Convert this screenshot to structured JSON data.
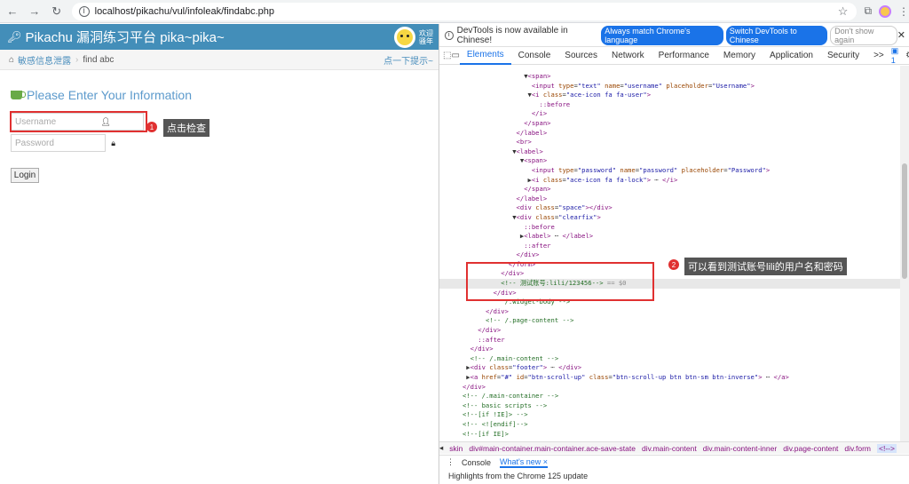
{
  "browser": {
    "url": "localhost/pikachu/vul/infoleak/findabc.php"
  },
  "page": {
    "brand": "Pikachu 漏洞练习平台 pika~pika~",
    "welcome": "欢迎\n骚年",
    "breadcrumb": {
      "section": "敏感信息泄露",
      "current": "find abc",
      "tip": "点一下提示~"
    },
    "form": {
      "title": "Please Enter Your Information",
      "username_placeholder": "Username",
      "password_placeholder": "Password",
      "login_label": "Login"
    },
    "annotations": {
      "one_number": "1",
      "one_label": "点击检查",
      "two_number": "2",
      "two_label": "可以看到测试账号lili的用户名和密码"
    }
  },
  "devtools": {
    "banner": {
      "text": "DevTools is now available in Chinese!",
      "btn_match": "Always match Chrome's language",
      "btn_switch": "Switch DevTools to Chinese",
      "btn_dismiss": "Don't show again"
    },
    "tabs": [
      "Elements",
      "Console",
      "Sources",
      "Network",
      "Performance",
      "Memory",
      "Application",
      "Security",
      ">>"
    ],
    "active_tab": "Elements",
    "issue_count": "1",
    "crumbs": [
      "skin",
      "div#main-container.main-container.ace-save-state",
      "div.main-content",
      "div.main-content-inner",
      "div.page-content",
      "div.form",
      "<!-->"
    ],
    "drawer_tabs": [
      "Console",
      "What's new ×"
    ],
    "drawer_text": "Highlights from the Chrome 125 update"
  }
}
